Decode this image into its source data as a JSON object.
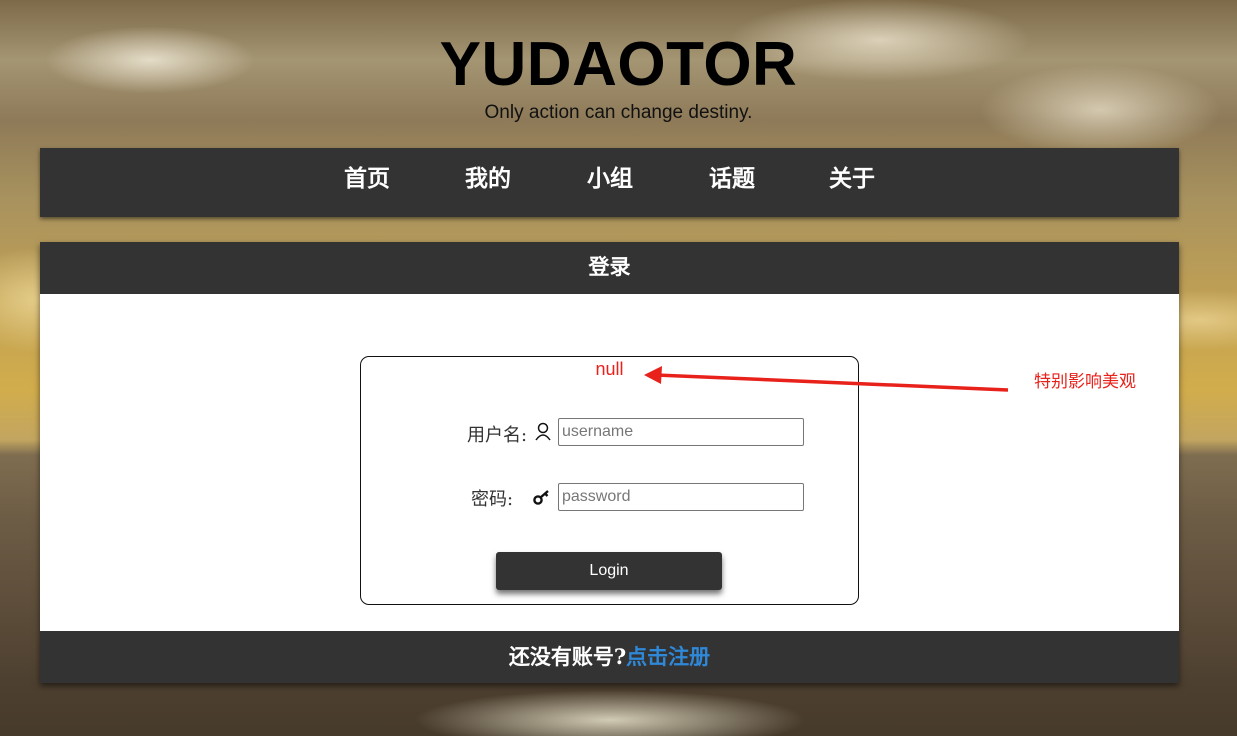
{
  "header": {
    "title": "YUDAOTOR",
    "subtitle": "Only action can change destiny."
  },
  "nav": {
    "items": [
      "首页",
      "我的",
      "小组",
      "话题",
      "关于"
    ]
  },
  "login_panel": {
    "title": "登录",
    "error_message": "null",
    "username_label": "用户名:",
    "username_placeholder": "username",
    "username_value": "",
    "password_label": "密码:",
    "password_placeholder": "password",
    "password_value": "",
    "login_button": "Login",
    "footer_prompt": "还没有账号?",
    "register_link": "点击注册"
  },
  "annotation": {
    "text": "特别影响美观",
    "color": "#e8211b"
  },
  "colors": {
    "bar_background": "#333333",
    "link": "#2f88d8",
    "error": "#e8211b"
  },
  "icons": {
    "username": "user-icon",
    "password": "key-icon"
  }
}
